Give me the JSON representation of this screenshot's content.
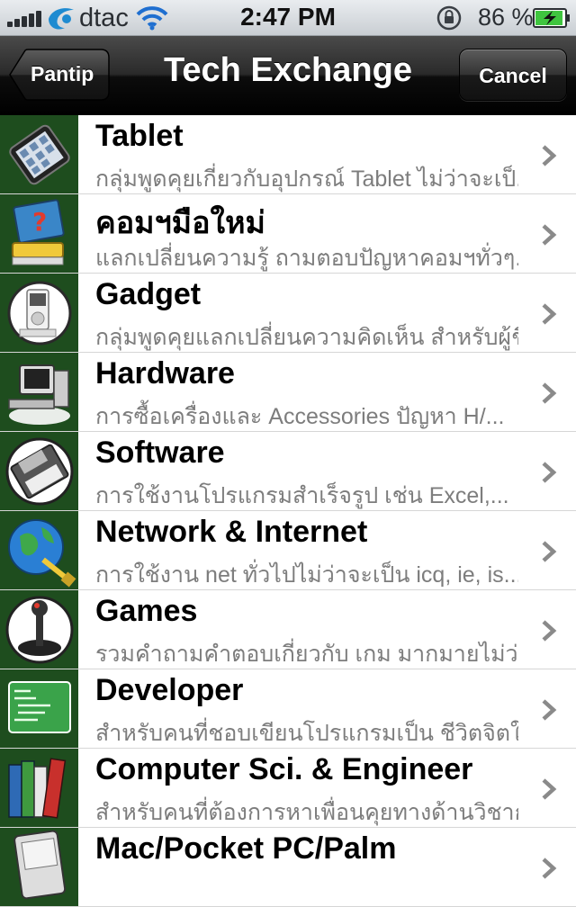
{
  "status": {
    "carrier": "dtac",
    "time": "2:47 PM",
    "battery": "86 %"
  },
  "nav": {
    "back_label": "Pantip",
    "title": "Tech Exchange",
    "cancel_label": "Cancel"
  },
  "items": [
    {
      "title": "Tablet",
      "subtitle": "กลุ่มพูดคุยเกี่ยวกับอุปกรณ์ Tablet ไม่ว่าจะเป็...",
      "icon": "tablet-icon"
    },
    {
      "title": "คอมฯมือใหม่",
      "subtitle": "แลกเปลี่ยนความรู้ ถามตอบปัญหาคอมฯทั่วๆ...",
      "icon": "help-computer-icon"
    },
    {
      "title": "Gadget",
      "subtitle": "กลุ่มพูดคุยแลกเปลี่ยนความคิดเห็น สำหรับผู้ชื่น...",
      "icon": "ipod-icon"
    },
    {
      "title": "Hardware",
      "subtitle": "การซื้อเครื่องและ Accessories ปัญหา H/...",
      "icon": "desktop-computer-icon"
    },
    {
      "title": "Software",
      "subtitle": "การใช้งานโปรแกรมสำเร็จรูป เช่น Excel,...",
      "icon": "floppy-disk-icon"
    },
    {
      "title": "Network & Internet",
      "subtitle": "การใช้งาน net ทั่วไปไม่ว่าจะเป็น icq, ie, is...",
      "icon": "globe-cable-icon"
    },
    {
      "title": "Games",
      "subtitle": "รวมคำถามคำตอบเกี่ยวกับ เกม มากมายไม่ว่า...",
      "icon": "joystick-icon"
    },
    {
      "title": "Developer",
      "subtitle": "สำหรับคนที่ชอบเขียนโปรแกรมเป็น ชีวิตจิตใจ...",
      "icon": "code-screen-icon"
    },
    {
      "title": "Computer Sci. & Engineer",
      "subtitle": "สำหรับคนที่ต้องการหาเพื่อนคุยทางด้านวิชากา...",
      "icon": "books-icon"
    },
    {
      "title": "Mac/Pocket PC/Palm",
      "subtitle": "",
      "icon": "pda-icon"
    }
  ]
}
